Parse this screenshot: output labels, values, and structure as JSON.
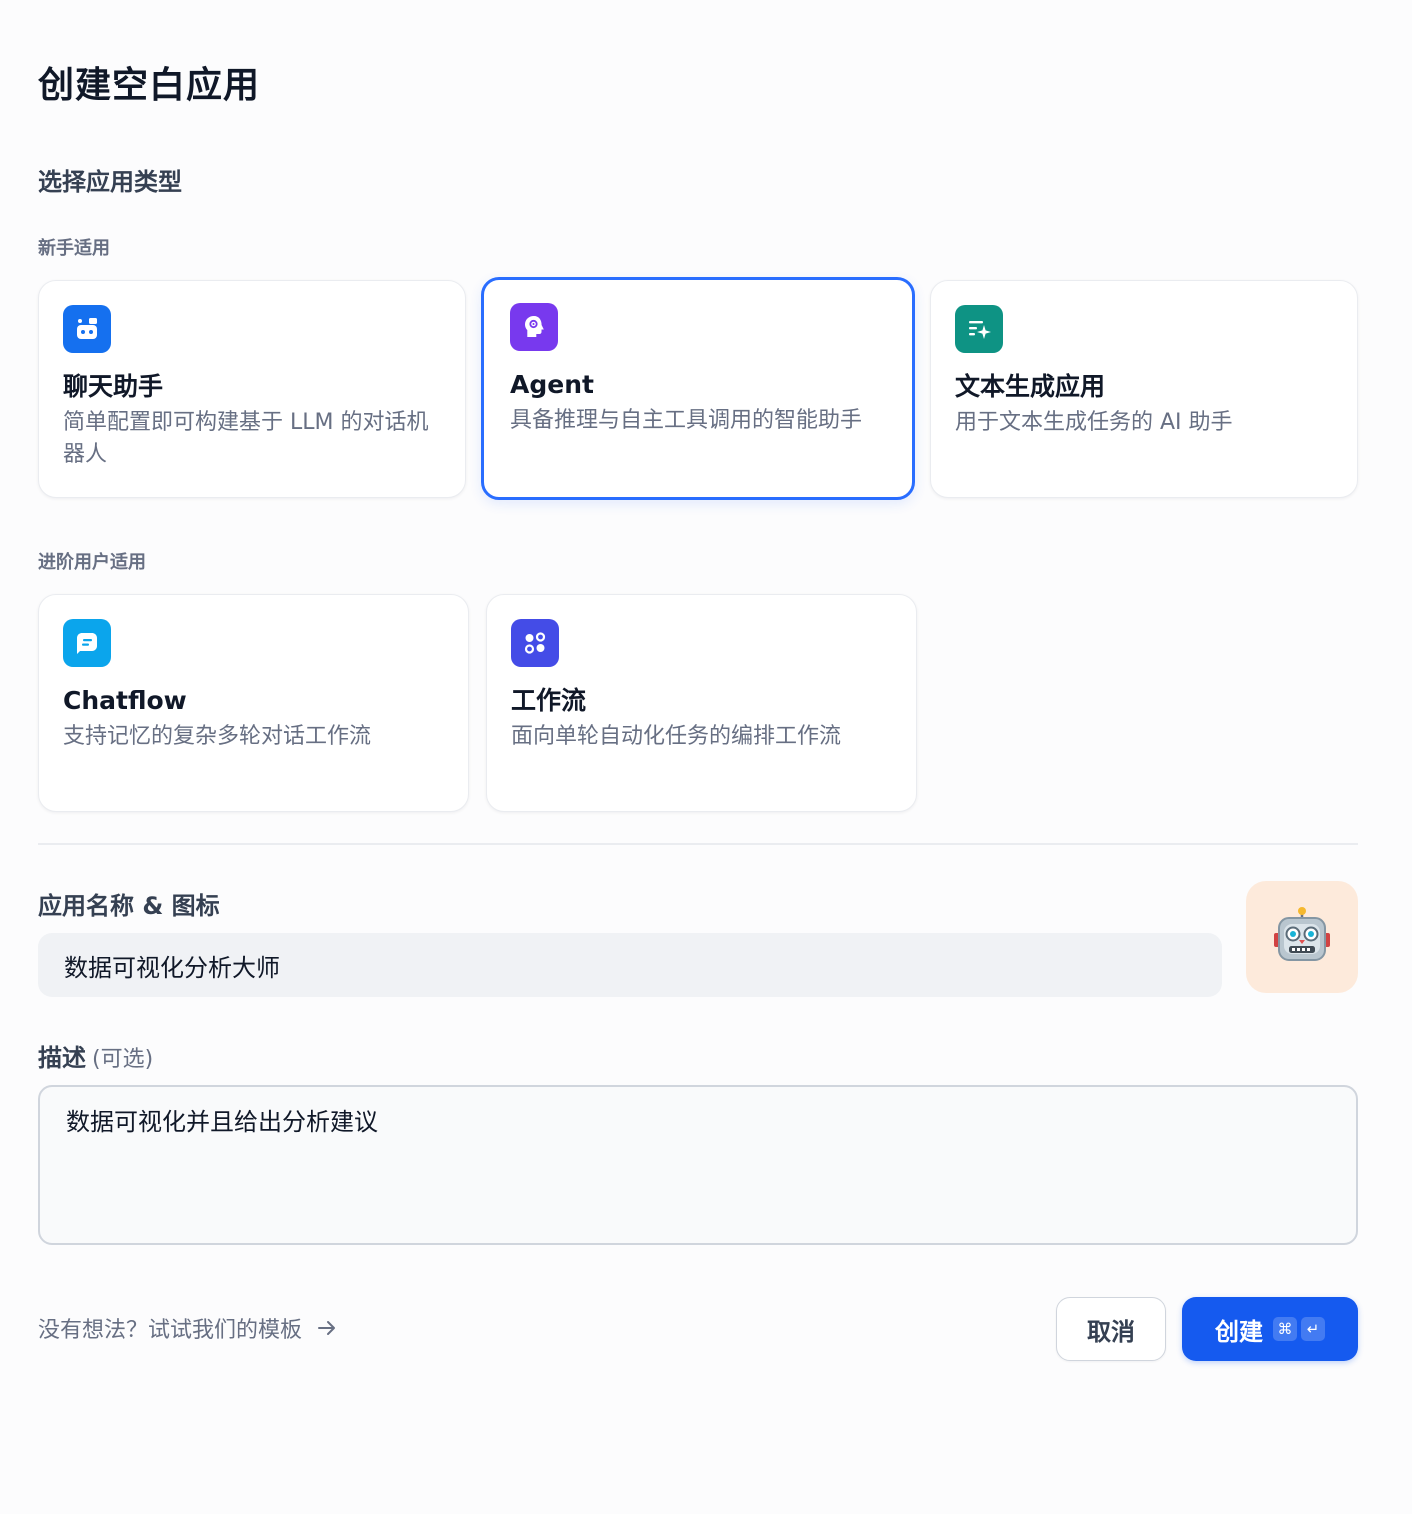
{
  "dialog": {
    "title": "创建空白应用",
    "section_title": "选择应用类型"
  },
  "groups": {
    "beginner": "新手适用",
    "advanced": "进阶用户适用"
  },
  "app_types": {
    "chatbot": {
      "title": "聊天助手",
      "desc": "简单配置即可构建基于 LLM 的对话机器人",
      "icon": "chat-bot-icon",
      "color": "#1570ef"
    },
    "agent": {
      "title": "Agent",
      "desc": "具备推理与自主工具调用的智能助手",
      "icon": "agent-brain-icon",
      "color": "#7839ee",
      "selected": true
    },
    "completion": {
      "title": "文本生成应用",
      "desc": "用于文本生成任务的 AI 助手",
      "icon": "text-sparkle-icon",
      "color": "#0e9384"
    },
    "chatflow": {
      "title": "Chatflow",
      "desc": "支持记忆的复杂多轮对话工作流",
      "icon": "chatflow-icon",
      "color": "#0ba5ec"
    },
    "workflow": {
      "title": "工作流",
      "desc": "面向单轮自动化任务的编排工作流",
      "icon": "workflow-icon",
      "color": "#444ce7"
    }
  },
  "form": {
    "name_label": "应用名称 & 图标",
    "name_value": "数据可视化分析大师",
    "app_icon": "robot-emoji-icon",
    "app_icon_bg": "#fdeadb",
    "desc_label": "描述",
    "desc_optional": "(可选)",
    "desc_value": "数据可视化并且给出分析建议"
  },
  "footer": {
    "template_link": "没有想法？试试我们的模板",
    "cancel_label": "取消",
    "create_label": "创建",
    "shortcut_cmd": "⌘",
    "shortcut_enter": "↵"
  },
  "colors": {
    "primary": "#155aef",
    "selected_border": "#296dff"
  }
}
